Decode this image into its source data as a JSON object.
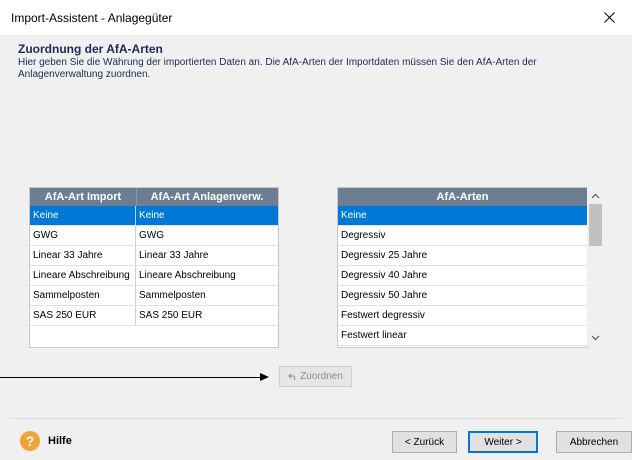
{
  "window": {
    "title": "Import-Assistent - Anlagegüter"
  },
  "header": {
    "title": "Zuordnung der AfA-Arten",
    "description": "Hier geben Sie die Währung der importierten Daten an. Die AfA-Arten der Importdaten müssen Sie den AfA-Arten der Anlagenverwaltung zuordnen."
  },
  "left_table": {
    "columns": [
      "AfA-Art Import",
      "AfA-Art Anlagenverw."
    ],
    "rows": [
      [
        "Keine",
        "Keine"
      ],
      [
        "GWG",
        "GWG"
      ],
      [
        "Linear 33 Jahre",
        "Linear 33 Jahre"
      ],
      [
        "Lineare Abschreibung",
        "Lineare Abschreibung"
      ],
      [
        "Sammelposten",
        "Sammelposten"
      ],
      [
        "SAS 250 EUR",
        "SAS 250 EUR"
      ]
    ],
    "selected_row": 0
  },
  "right_table": {
    "column": "AfA-Arten",
    "rows": [
      "Keine",
      "Degressiv",
      "Degressiv 25 Jahre",
      "Degressiv 40 Jahre",
      "Degressiv 50 Jahre",
      "Festwert degressiv",
      "Festwert linear"
    ],
    "selected_row": 0
  },
  "buttons": {
    "assign": "Zuordnen",
    "help": "Hilfe",
    "back": "< Zurück",
    "next": "Weiter >",
    "cancel": "Abbrechen"
  },
  "colors": {
    "selection": "#0078d7",
    "grid_header": "#6d7e93",
    "header_text": "#1c2a55",
    "help_icon": "#f2a23a"
  },
  "icons": {
    "assign": "undo-arrow-icon",
    "help": "question-circle-icon",
    "close": "close-icon"
  }
}
